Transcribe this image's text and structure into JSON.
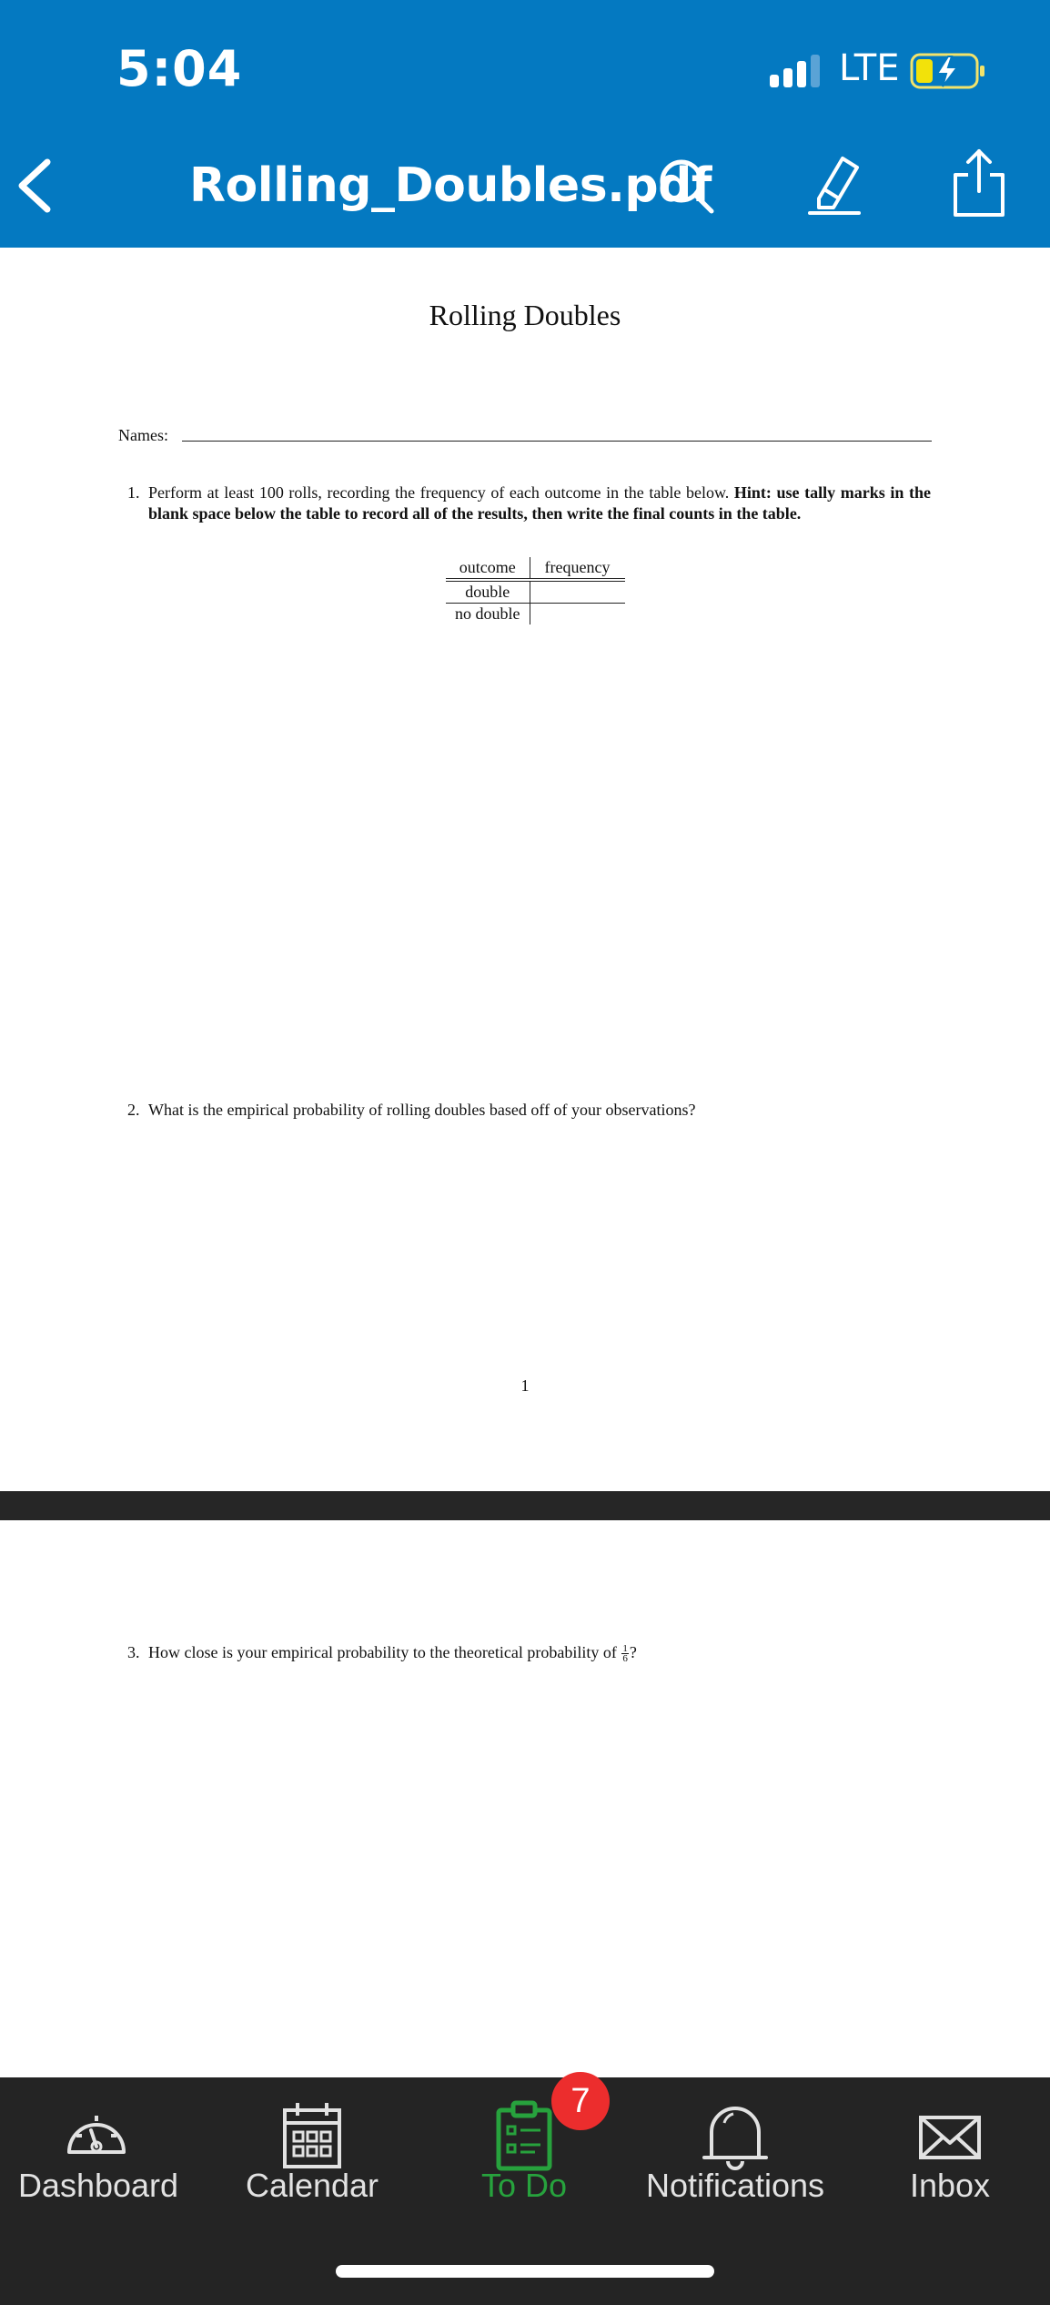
{
  "status_bar": {
    "time": "5:04",
    "network": "LTE"
  },
  "nav_bar": {
    "title": "Rolling_Doubles.pdf"
  },
  "document": {
    "title": "Rolling Doubles",
    "names_label": "Names:",
    "questions": [
      {
        "number": "1.",
        "text": "Perform at least 100 rolls, recording the frequency of each outcome in the table below.",
        "hint": "Hint: use tally marks in the blank space below the table to record all of the results, then write the final counts in the table."
      },
      {
        "number": "2.",
        "text": "What is the empirical probability of rolling doubles based off of your observations?"
      },
      {
        "number": "3.",
        "text": "How close is your empirical probability to the theoretical probability of",
        "fraction_numerator": "1",
        "fraction_denominator": "6",
        "suffix": "?"
      }
    ],
    "table": {
      "headers": [
        "outcome",
        "frequency"
      ],
      "rows": [
        [
          "double",
          ""
        ],
        [
          "no double",
          ""
        ]
      ]
    },
    "page_number": "1"
  },
  "tab_bar": {
    "items": [
      {
        "label": "Dashboard",
        "icon": "dashboard-icon"
      },
      {
        "label": "Calendar",
        "icon": "calendar-icon"
      },
      {
        "label": "To Do",
        "icon": "todo-icon",
        "badge": "7",
        "active": true
      },
      {
        "label": "Notifications",
        "icon": "bell-icon"
      },
      {
        "label": "Inbox",
        "icon": "envelope-icon"
      }
    ]
  },
  "colors": {
    "header_blue": "#0479c1",
    "tab_bar_bg": "#242424",
    "active_green": "#27a23d",
    "badge_red": "#ec2d2d"
  }
}
